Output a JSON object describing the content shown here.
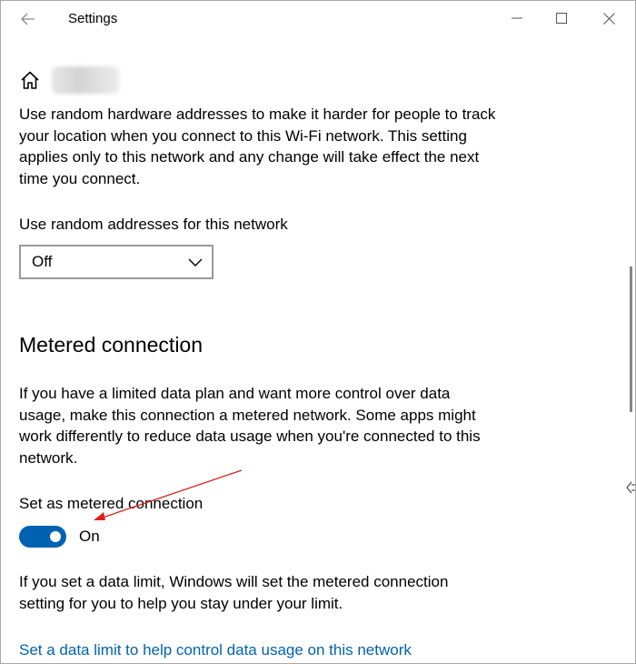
{
  "window": {
    "title": "Settings"
  },
  "mac_randomization": {
    "description": "Use random hardware addresses to make it harder for people to track your location when you connect to this Wi-Fi network. This setting applies only to this network and any change will take effect the next time you connect.",
    "label": "Use random addresses for this network",
    "selected_value": "Off"
  },
  "metered": {
    "heading": "Metered connection",
    "description": "If you have a limited data plan and want more control over data usage, make this connection a metered network. Some apps might work differently to reduce data usage when you're connected to this network.",
    "toggle_label": "Set as metered connection",
    "toggle_state": "On",
    "toggle_on": true,
    "data_limit_note": "If you set a data limit, Windows will set the metered connection setting for you to help you stay under your limit.",
    "data_limit_link": "Set a data limit to help control data usage on this network"
  },
  "colors": {
    "accent": "#0063b1",
    "annotation_arrow": "#e0201b"
  },
  "icons": [
    "back-arrow-icon",
    "minimize-icon",
    "maximize-icon",
    "close-icon",
    "home-icon",
    "chevron-down-icon",
    "resize-cursor-icon"
  ]
}
